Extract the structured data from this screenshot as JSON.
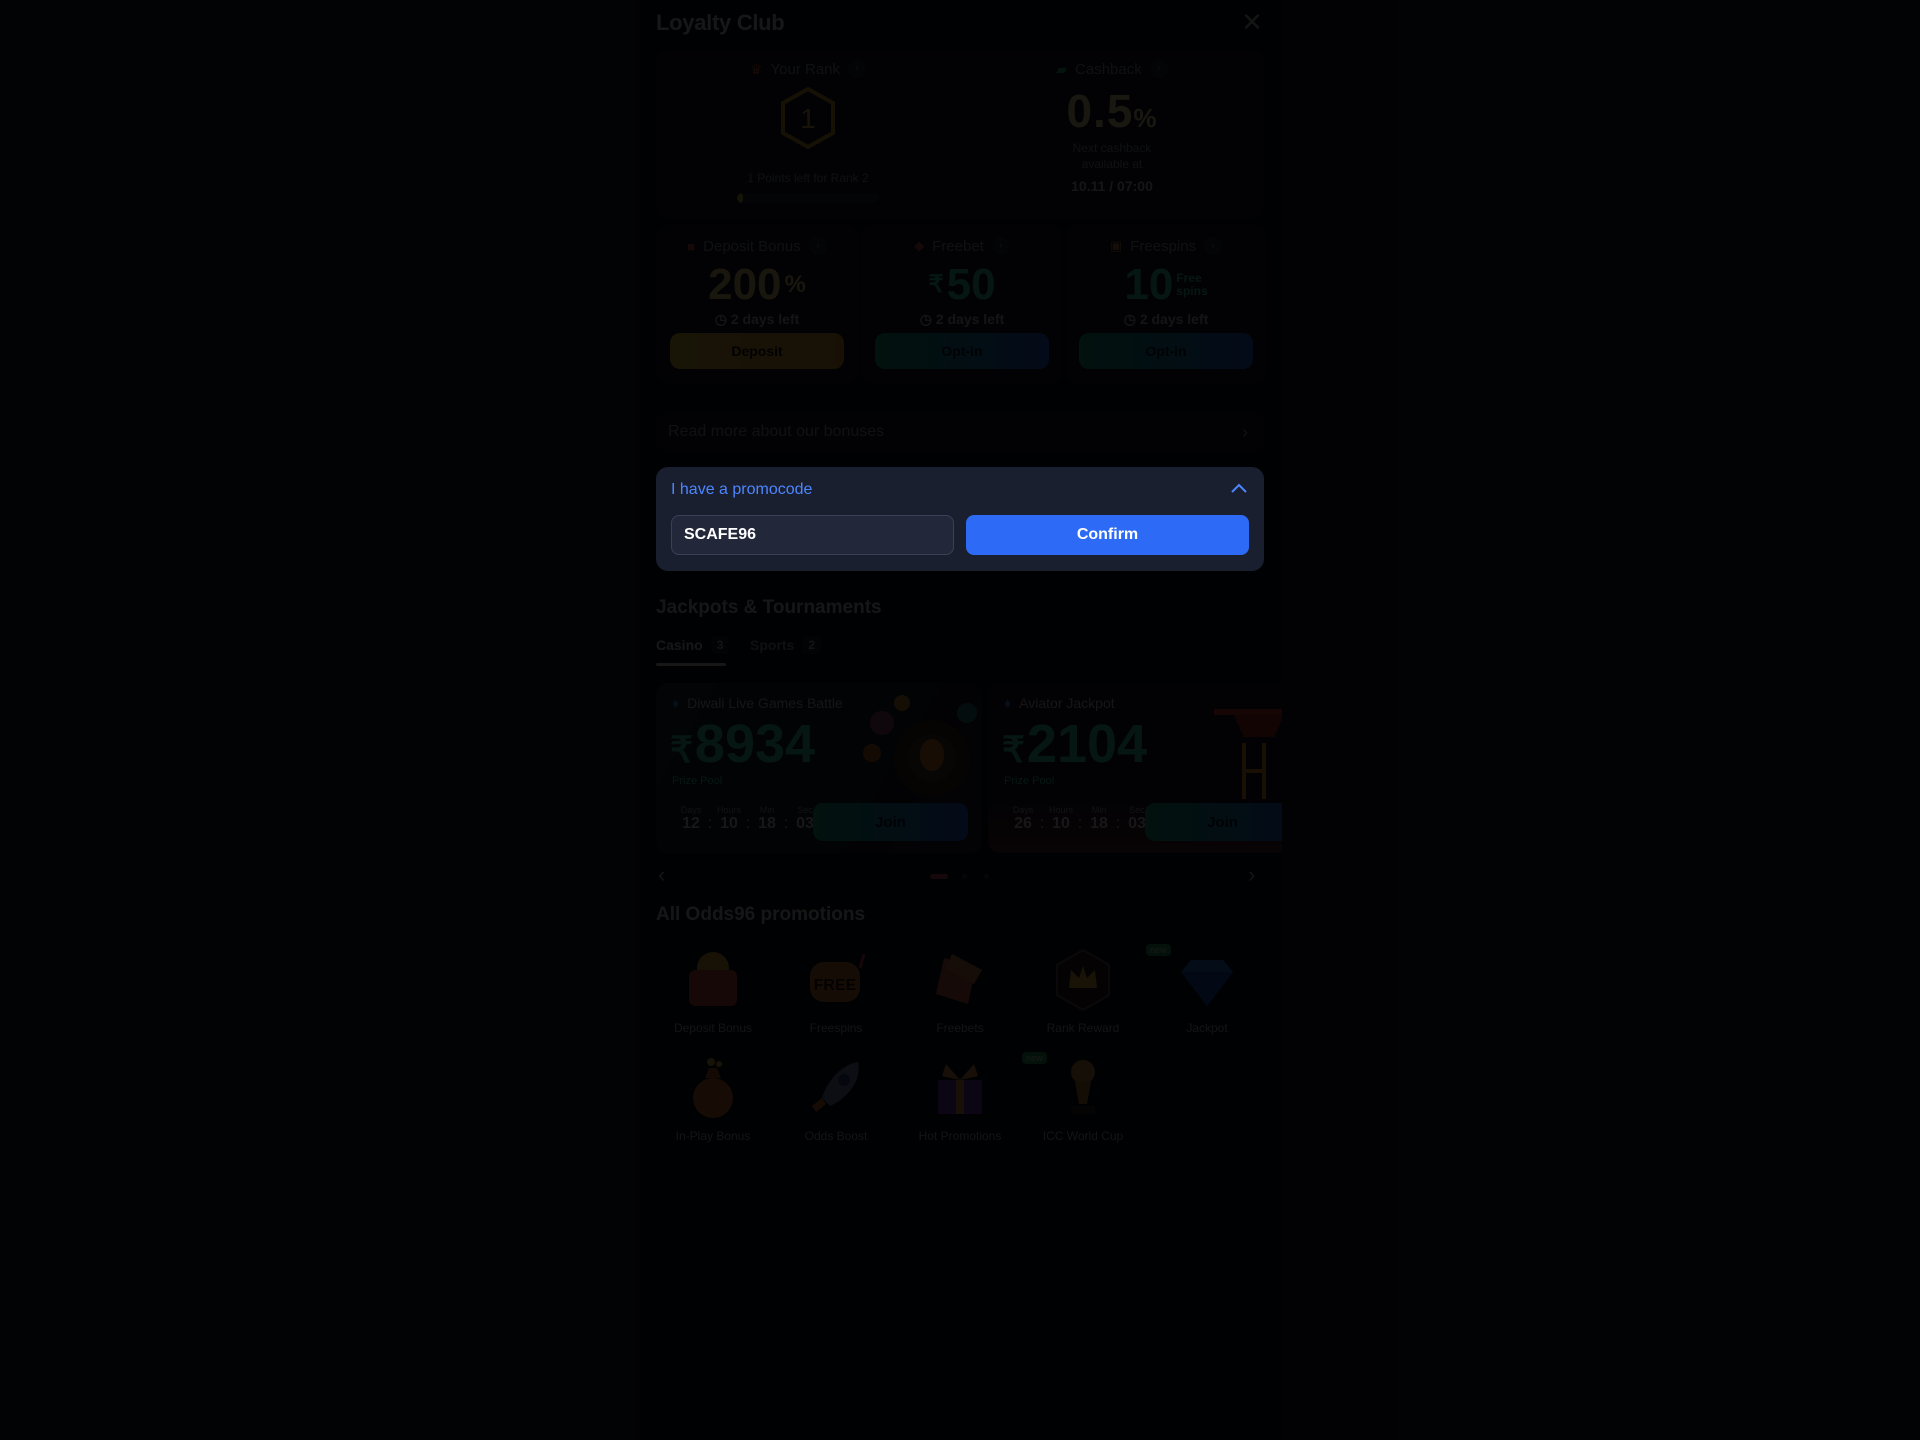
{
  "modal": {
    "title": "Loyalty Club",
    "close_icon": "close-icon"
  },
  "rank": {
    "label": "Your Rank",
    "value": "1",
    "points_left_text": "1 Points left for Rank 2",
    "progress_fraction": 0.04,
    "color": "#e2c54c"
  },
  "cashback": {
    "label": "Cashback",
    "value": "0.5",
    "unit": "%",
    "next_line1": "Next cashback",
    "next_line2": "available at",
    "next_date": "10.11 / 07:00"
  },
  "bonuses": [
    {
      "label": "Deposit Bonus",
      "value": "200",
      "suffix": "%",
      "days_left": "2 days left",
      "button": "Deposit",
      "value_color": "#f2e08a"
    },
    {
      "label": "Freebet",
      "prefix": "₹",
      "value": "50",
      "days_left": "2 days left",
      "button": "Opt-in",
      "value_color": "#3ee0b3"
    },
    {
      "label": "Freespins",
      "value": "10",
      "suffix_line1": "Free",
      "suffix_line2": "spins",
      "days_left": "2 days left",
      "button": "Opt-in",
      "value_color": "#3ee0b3"
    }
  ],
  "read_more": "Read more about our bonuses",
  "promocode": {
    "header": "I have a promocode",
    "value": "SCAFE96",
    "confirm_label": "Confirm"
  },
  "jackpots": {
    "title": "Jackpots & Tournaments",
    "tabs": [
      {
        "label": "Casino",
        "count": "3",
        "active": true
      },
      {
        "label": "Sports",
        "count": "2",
        "active": false
      }
    ],
    "cards": [
      {
        "name": "Diwali Live Games Battle",
        "currency": "₹",
        "amount": "8934",
        "pool_label": "Prize Pool",
        "timer": {
          "days_label": "Days",
          "hours_label": "Hours",
          "min_label": "Min",
          "sec_label": "Sec",
          "days": "12",
          "hours": "10",
          "min": "18",
          "sec": "03"
        },
        "join_label": "Join"
      },
      {
        "name": "Aviator Jackpot",
        "currency": "₹",
        "amount": "2104",
        "pool_label": "Prize Pool",
        "timer": {
          "days_label": "Days",
          "hours_label": "Hours",
          "min_label": "Min",
          "sec_label": "Sec",
          "days": "26",
          "hours": "10",
          "min": "18",
          "sec": "03"
        },
        "join_label": "Join"
      }
    ],
    "carousel_pages": 3,
    "carousel_active": 1
  },
  "promotions": {
    "title": "All Odds96 promotions",
    "items": [
      {
        "label": "Deposit Bonus",
        "icon": "wallet-icon",
        "new": false
      },
      {
        "label": "Freespins",
        "icon": "slot-free-icon",
        "new": false
      },
      {
        "label": "Freebets",
        "icon": "ticket-icon",
        "new": false
      },
      {
        "label": "Rank Reward",
        "icon": "crown-icon",
        "new": false
      },
      {
        "label": "Jackpot",
        "icon": "diamond-icon",
        "new": true
      },
      {
        "label": "In-Play Bonus",
        "icon": "money-bag-icon",
        "new": false
      },
      {
        "label": "Odds Boost",
        "icon": "rocket-icon",
        "new": false
      },
      {
        "label": "Hot Promotions",
        "icon": "gift-icon",
        "new": false
      },
      {
        "label": "ICC World Cup",
        "icon": "trophy-icon",
        "new": true
      }
    ],
    "new_badge": "new"
  }
}
